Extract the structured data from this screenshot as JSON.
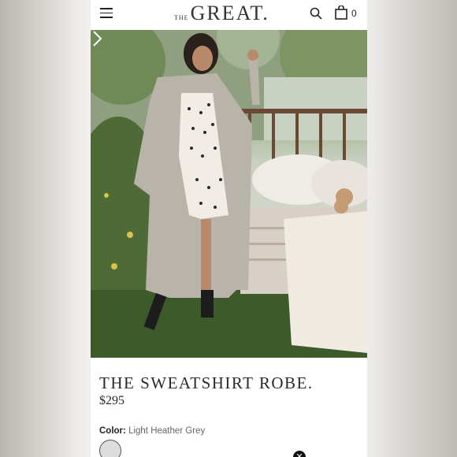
{
  "header": {
    "logo_prefix": "THE",
    "logo_main": "GREAT.",
    "bag_count": "0",
    "icons": [
      "menu-icon",
      "search-icon",
      "bag-icon"
    ]
  },
  "hero": {
    "alt": "Model in grey sweatshirt robe outdoors by a daybed",
    "icons": [
      "chevron-right-icon"
    ]
  },
  "product": {
    "title": "THE SWEATSHIRT ROBE.",
    "price": "$295",
    "color_label": "Color:",
    "color_value": "Light Heather Grey"
  },
  "colors": {
    "background": "#ffffff",
    "text": "#2a2a2a",
    "swatch": "#dcdcdc"
  }
}
